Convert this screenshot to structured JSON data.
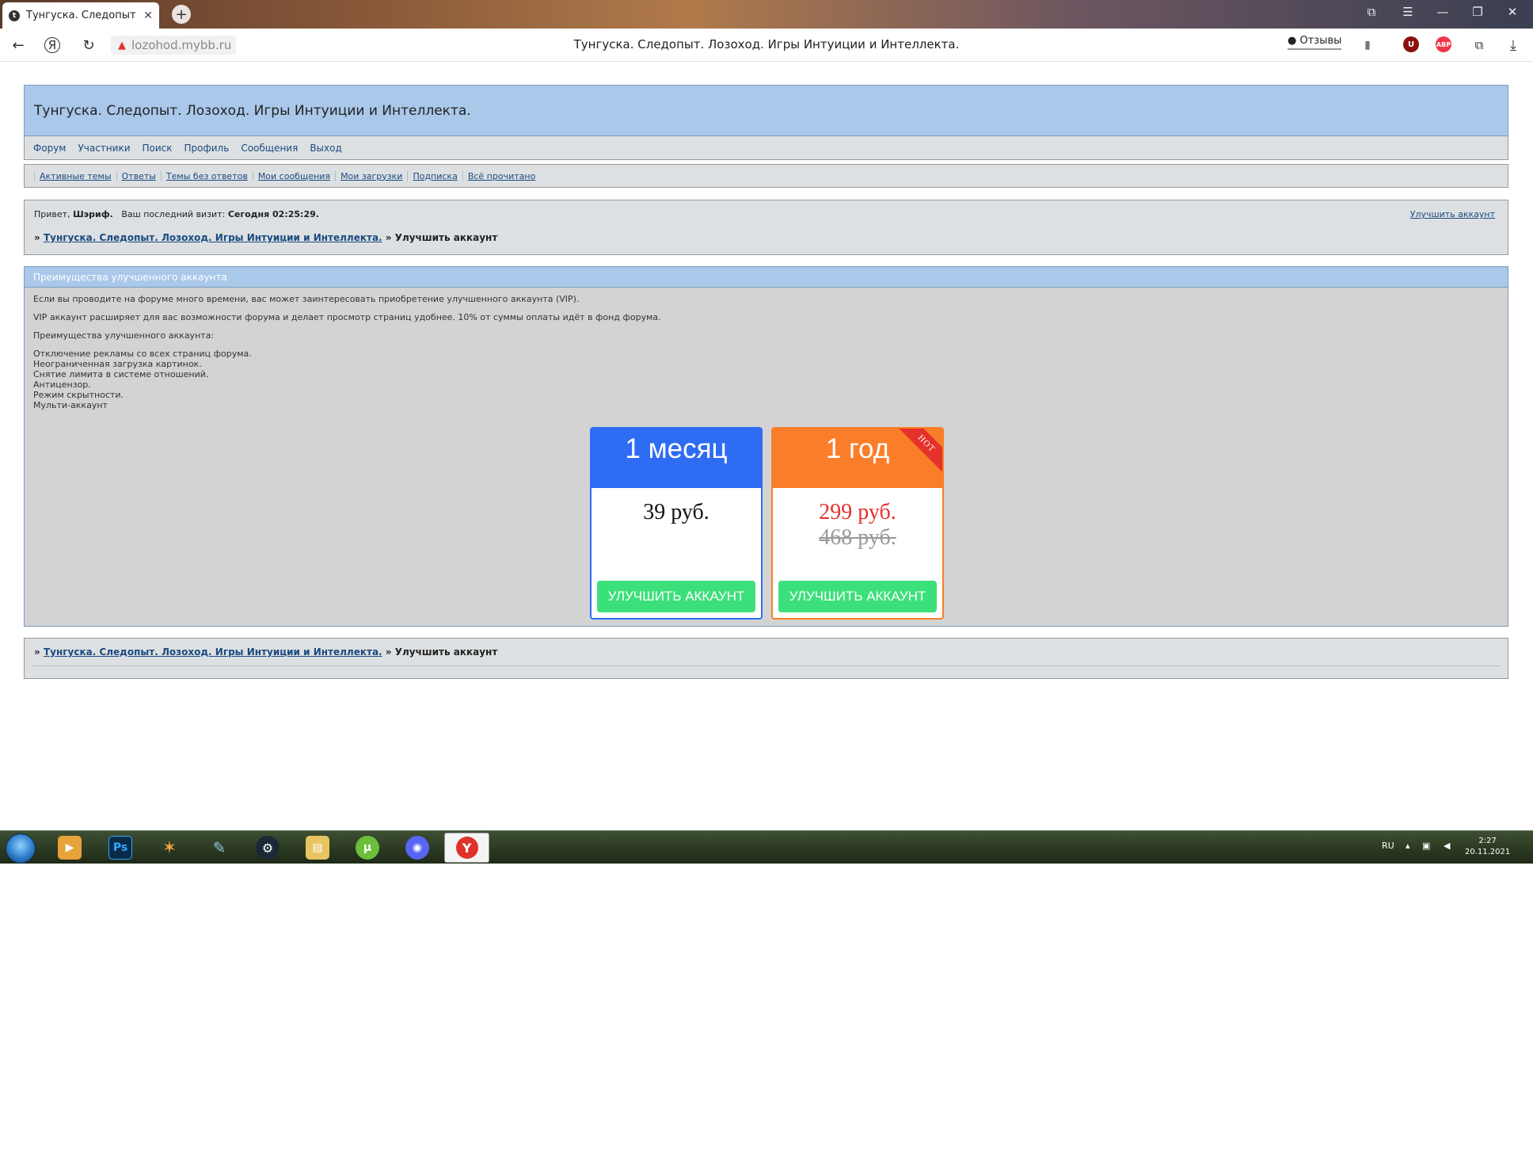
{
  "browser": {
    "tab_title": "Тунгуска. Следопыт. Ло",
    "tab_close": "✕",
    "new_tab": "+",
    "url_domain": "lozohod.mybb.ru",
    "page_title": "Тунгуска. Следопыт. Лозоход. Игры Интуиции и Интеллекта.",
    "reviews_label": "Отзывы",
    "ext_ublock": "U",
    "ext_abp": "ABP"
  },
  "forum": {
    "title": "Тунгуска. Следопыт. Лозоход. Игры Интуиции и Интеллекта.",
    "mainmenu": [
      "Форум",
      "Участники",
      "Поиск",
      "Профиль",
      "Сообщения",
      "Выход"
    ],
    "submenu": [
      "Активные темы",
      "Ответы",
      "Темы без ответов",
      "Мои сообщения",
      "Мои загрузки",
      "Подписка",
      "Всё прочитано"
    ],
    "welcome": {
      "hello": "Привет,",
      "username": "Шэриф.",
      "last_visit_label": "Ваш последний визит:",
      "last_visit_value": "Сегодня 02:25:29.",
      "upgrade_link": "Улучшить аккаунт"
    },
    "breadcrumb": {
      "prefix": "»",
      "forum_link": "Тунгуска. Следопыт. Лозоход. Игры Интуиции и Интеллекта.",
      "separator": "»",
      "current": "Улучшить аккаунт"
    },
    "vip": {
      "header": "Преимущества улучшенного аккаунта",
      "intro1": "Если вы проводите на форуме много времени, вас может заинтересовать приобретение улучшенного аккаунта (VIP).",
      "intro2": "VIP аккаунт расширяет для вас возможности форума и делает просмотр страниц удобнее. 10% от суммы оплаты идёт в фонд форума.",
      "perks_title": "Преимущества улучшенного аккаунта:",
      "perks": [
        "Отключение рекламы со всех страниц форума.",
        "Неограниченная загрузка картинок.",
        "Снятие лимита в системе отношений.",
        "Антицензор.",
        "Режим скрытности.",
        "Мульти-аккаунт"
      ]
    },
    "plans": [
      {
        "term": "1 месяц",
        "price": "39 руб.",
        "old_price": "",
        "button": "УЛУЧШИТЬ АККАУНТ",
        "accent": "#2e6cf3",
        "badge": ""
      },
      {
        "term": "1 год",
        "price": "299 руб.",
        "old_price": "468 руб.",
        "button": "УЛУЧШИТЬ АККАУНТ",
        "accent": "#fa7e2a",
        "badge": "HOT"
      }
    ]
  },
  "taskbar": {
    "lang": "RU",
    "time": "2:27",
    "date": "20.11.2021",
    "photoshop_label": "Ps"
  }
}
